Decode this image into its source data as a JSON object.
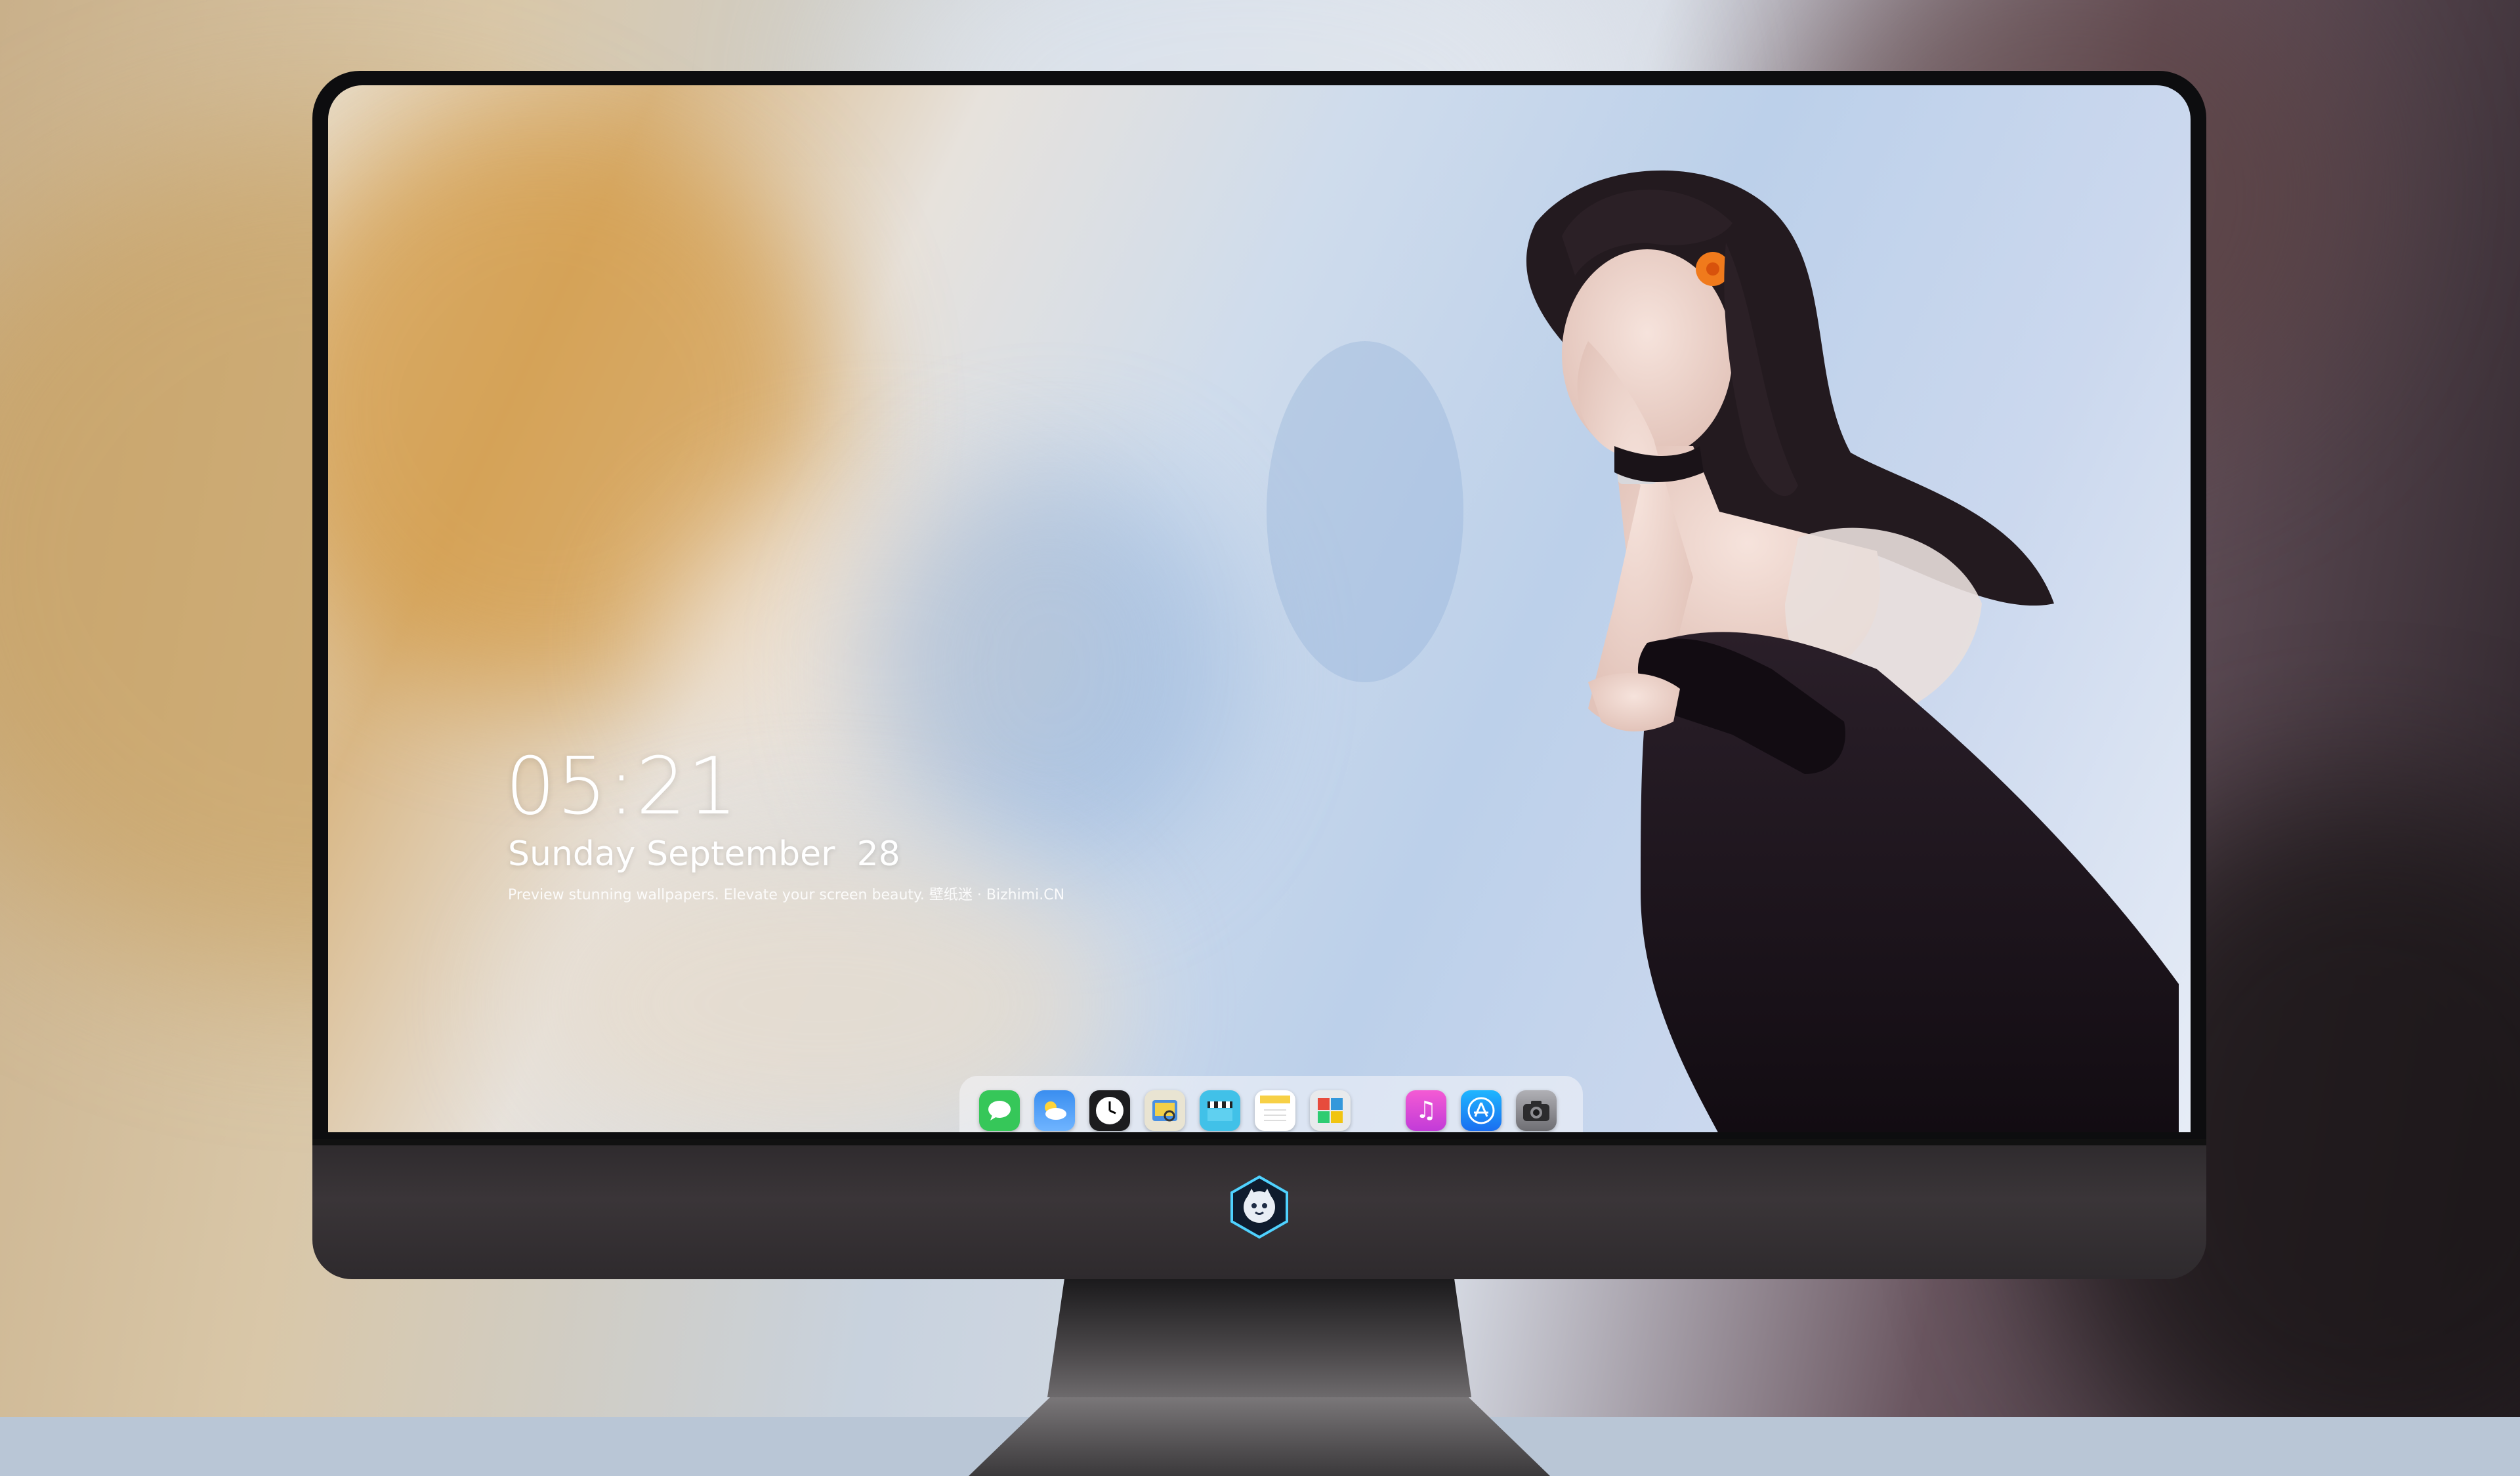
{
  "lockscreen": {
    "time": "05:21",
    "date": "Sunday September  28",
    "tagline": "Preview stunning wallpapers. Elevate your screen beauty. 壁纸迷 · Bizhimi.CN"
  },
  "dock": {
    "apps": [
      {
        "icon": "messages-icon",
        "color": "#36c759"
      },
      {
        "icon": "weather-icon",
        "color": "#3a8ef0"
      },
      {
        "icon": "clock-icon",
        "color": "#1c1c1e"
      },
      {
        "icon": "preview-icon",
        "color": "#f2d04a"
      },
      {
        "icon": "clips-icon",
        "color": "#41c1e8"
      },
      {
        "icon": "notes-icon",
        "color": "#f7d045"
      },
      {
        "icon": "photo-booth-icon",
        "color": "#e8eaec"
      },
      {
        "icon": "music-icon",
        "color": "#e948c4"
      },
      {
        "icon": "app-store-icon",
        "color": "#2c8cf5"
      },
      {
        "icon": "camera-icon",
        "color": "#8e8e93"
      }
    ]
  },
  "monitor": {
    "logo": "mascot-logo-icon"
  }
}
